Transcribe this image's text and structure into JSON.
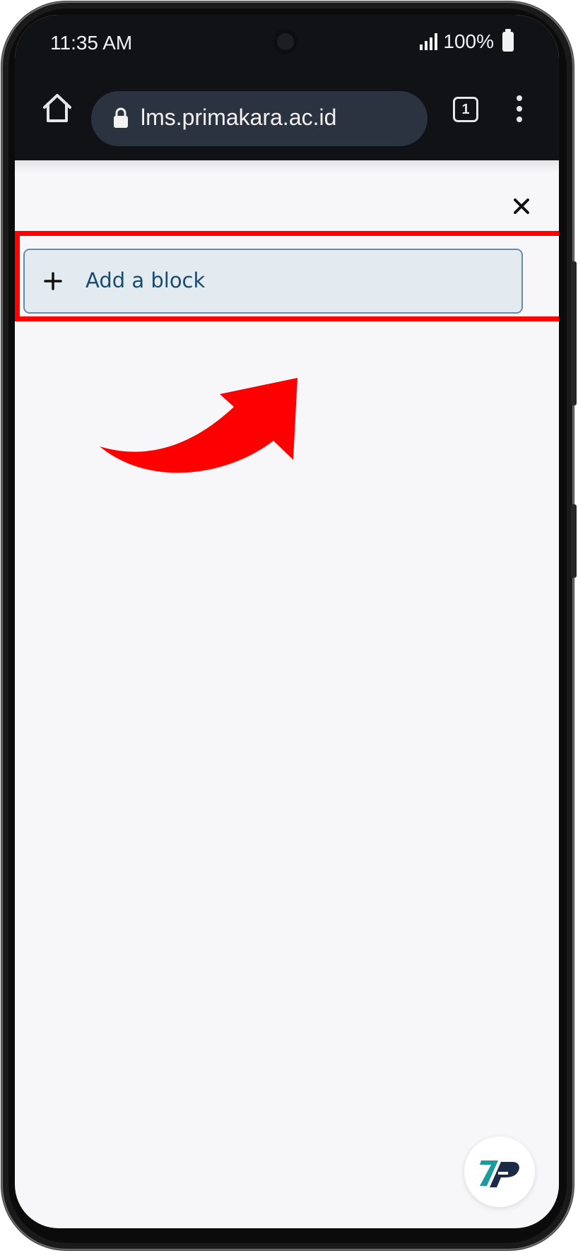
{
  "status_bar": {
    "time": "11:35 AM",
    "battery": "100%",
    "icons": [
      "signal-icon",
      "battery-icon"
    ]
  },
  "browser": {
    "url": "lms.primakara.ac.id",
    "tab_count": "1",
    "icons": [
      "home-icon",
      "lock-icon",
      "tabs-icon",
      "more-vert-icon"
    ]
  },
  "drawer": {
    "close_icon": "close-icon",
    "add_block_label": "Add a block",
    "add_block_icon": "plus-icon"
  },
  "annotation": {
    "highlight_color": "#ff0000",
    "arrow_color": "#ff0000"
  },
  "floating": {
    "logo_icon": "primakara-logo-icon"
  },
  "colors": {
    "status_bar_bg": "#101216",
    "url_pill_bg": "#2c3340",
    "page_bg": "#f7f7f9",
    "button_bg": "#e4ebf0",
    "button_border": "#6c8aa6",
    "button_text": "#174c6f"
  }
}
